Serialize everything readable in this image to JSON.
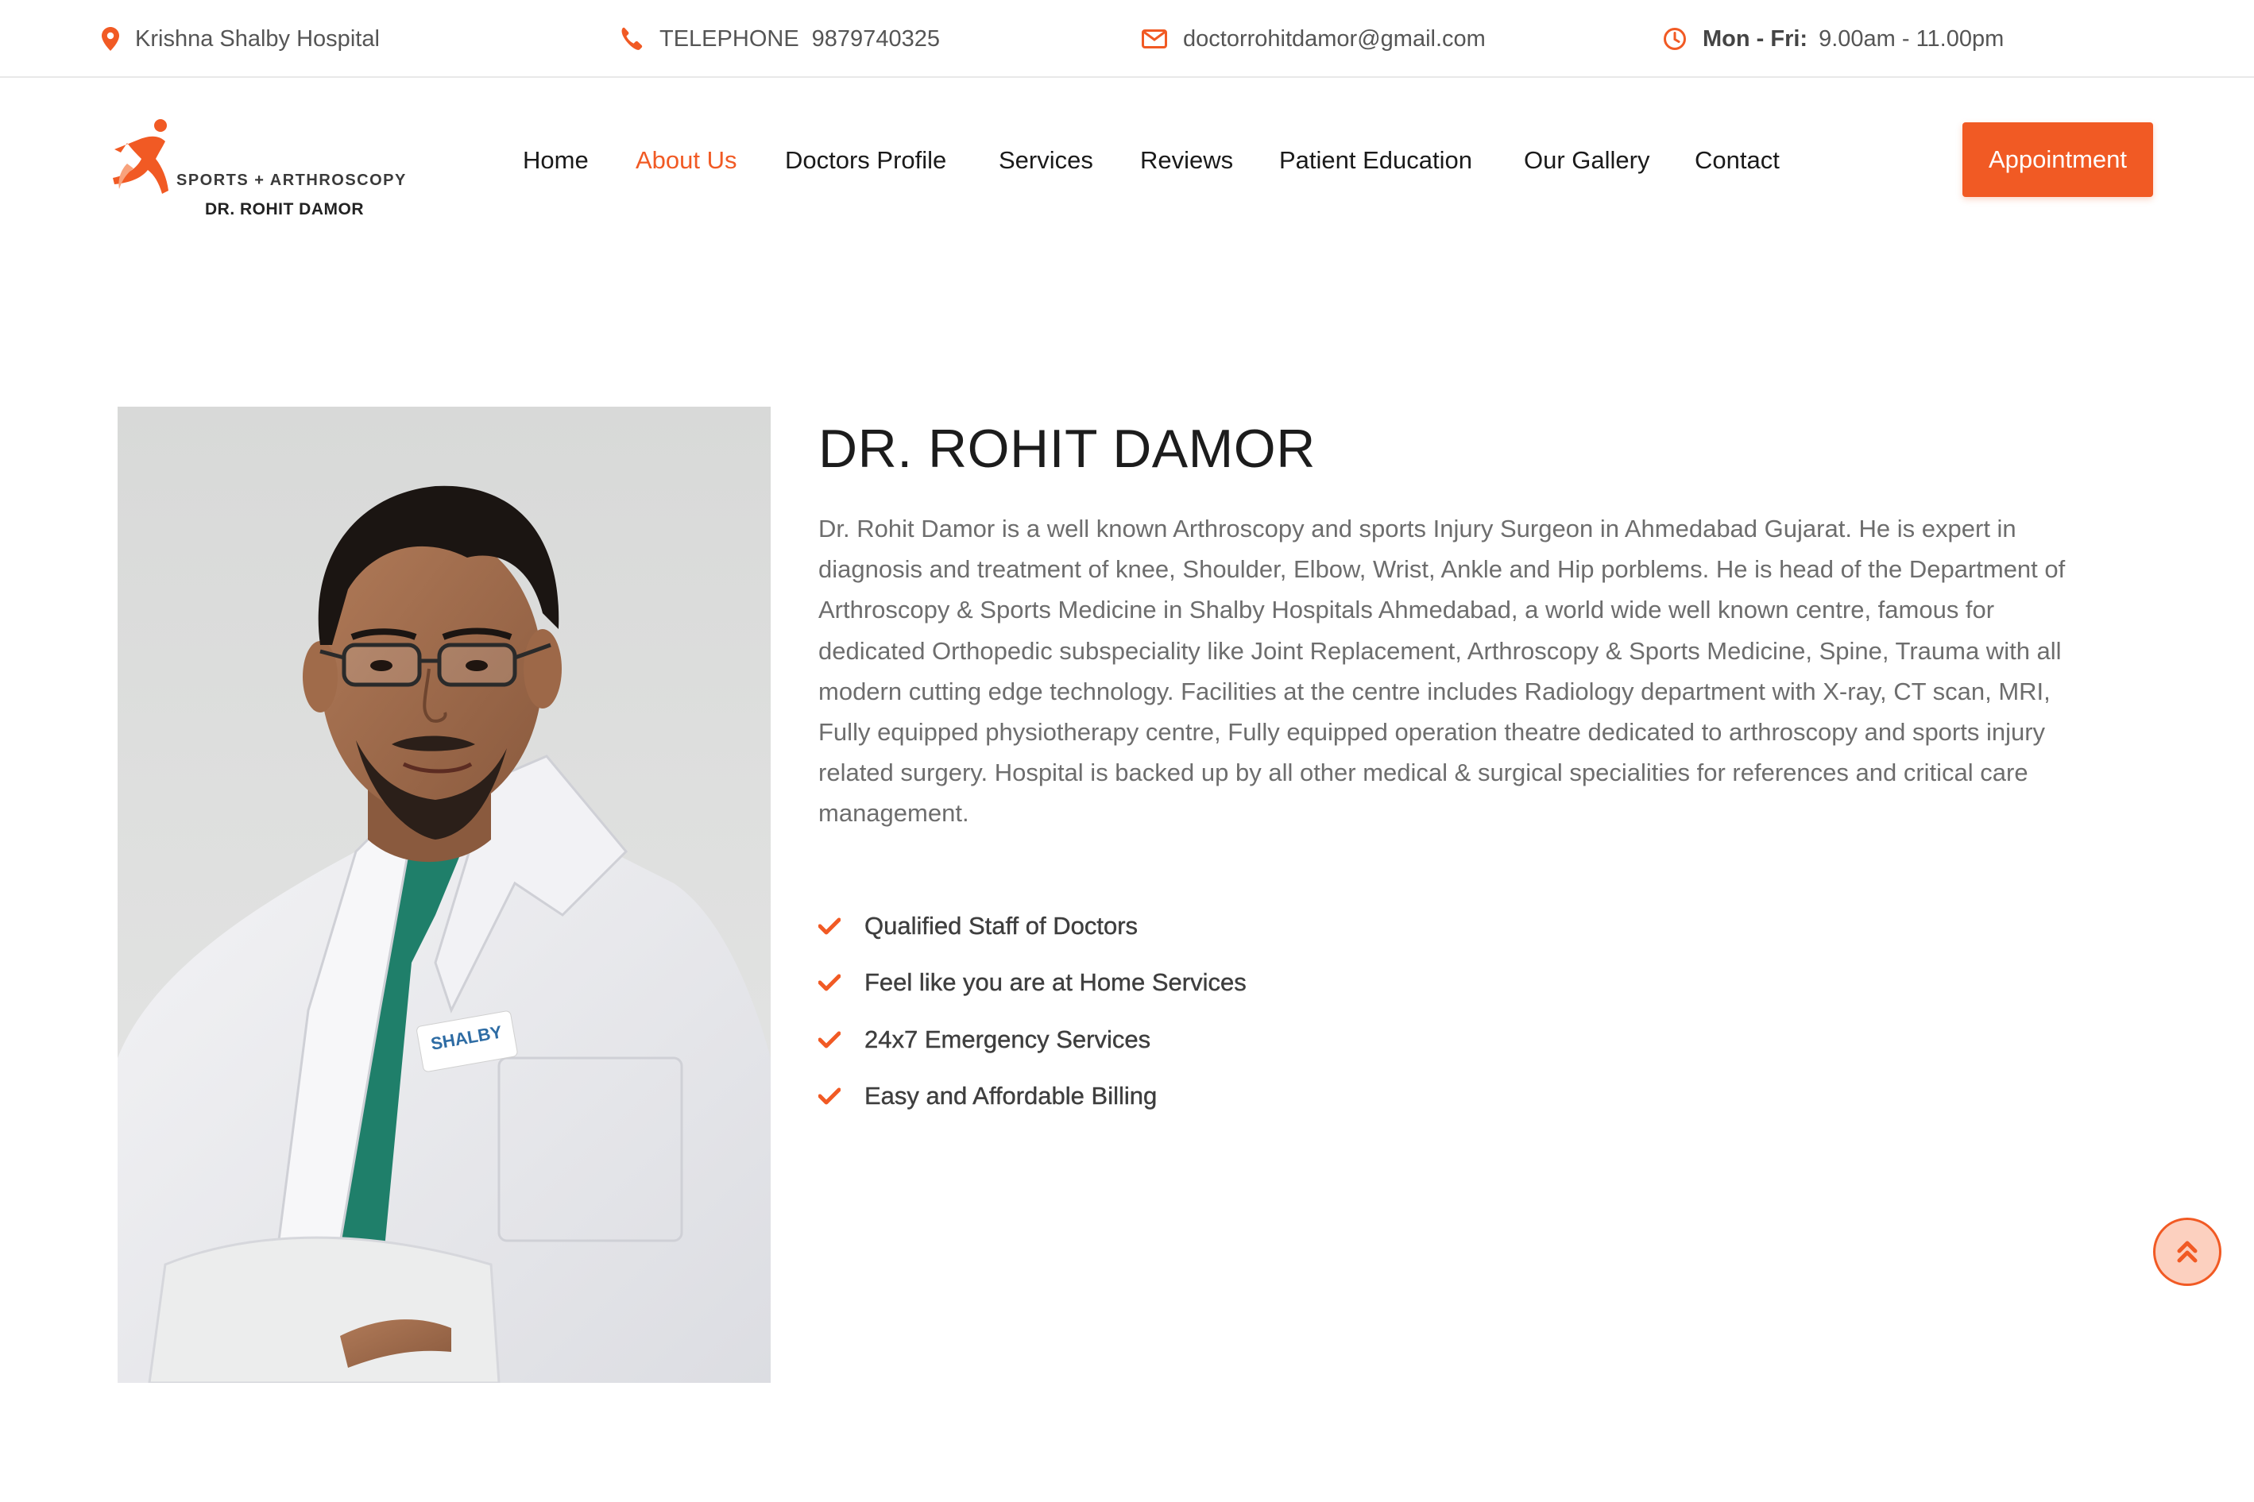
{
  "topbar": {
    "location": "Krishna Shalby Hospital",
    "phone_label": "TELEPHONE",
    "phone_number": "9879740325",
    "email": "doctorrohitdamor@gmail.com",
    "hours_days": "Mon - Fri:",
    "hours_time": "9.00am - 11.00pm"
  },
  "logo": {
    "line1": "SPORTS + ARTHROSCOPY",
    "line2": "DR. ROHIT DAMOR"
  },
  "nav": {
    "items": [
      "Home",
      "About Us",
      "Doctors Profile",
      "Services",
      "Reviews",
      "Patient Education",
      "Our Gallery",
      "Contact"
    ],
    "active": "About Us",
    "cta": "Appointment"
  },
  "about": {
    "name": "DR. ROHIT DAMOR",
    "bio": "Dr. Rohit Damor is a well known Arthroscopy and sports Injury Surgeon in Ahmedabad Gujarat. He is expert in diagnosis and treatment of knee, Shoulder, Elbow, Wrist, Ankle and Hip porblems. He is head of the Department of Arthroscopy & Sports Medicine in Shalby Hospitals Ahmedabad, a world wide well known centre, famous for dedicated Orthopedic subspeciality like Joint Replacement, Arthroscopy & Sports Medicine, Spine, Trauma with all modern cutting edge technology. Facilities at the centre includes Radiology department with X-ray, CT scan, MRI, Fully equipped physiotherapy centre, Fully equipped operation theatre dedicated to arthroscopy and sports injury related surgery. Hospital is backed up by all other medical & surgical specialities for references and critical care management.",
    "features": [
      "Qualified Staff of Doctors",
      "Feel like you are at Home Services",
      "24x7 Emergency Services",
      "Easy and Affordable Billing"
    ],
    "coat_badge": "SHALBY"
  },
  "colors": {
    "accent": "#f15a24",
    "text_dark": "#1c1c1c",
    "text_body": "#6d6d6d",
    "border": "#e8e8e8"
  },
  "icons": [
    "map-pin-icon",
    "phone-icon",
    "envelope-icon",
    "clock-icon",
    "check-icon",
    "chevron-double-up-icon",
    "logo-runner-icon"
  ]
}
